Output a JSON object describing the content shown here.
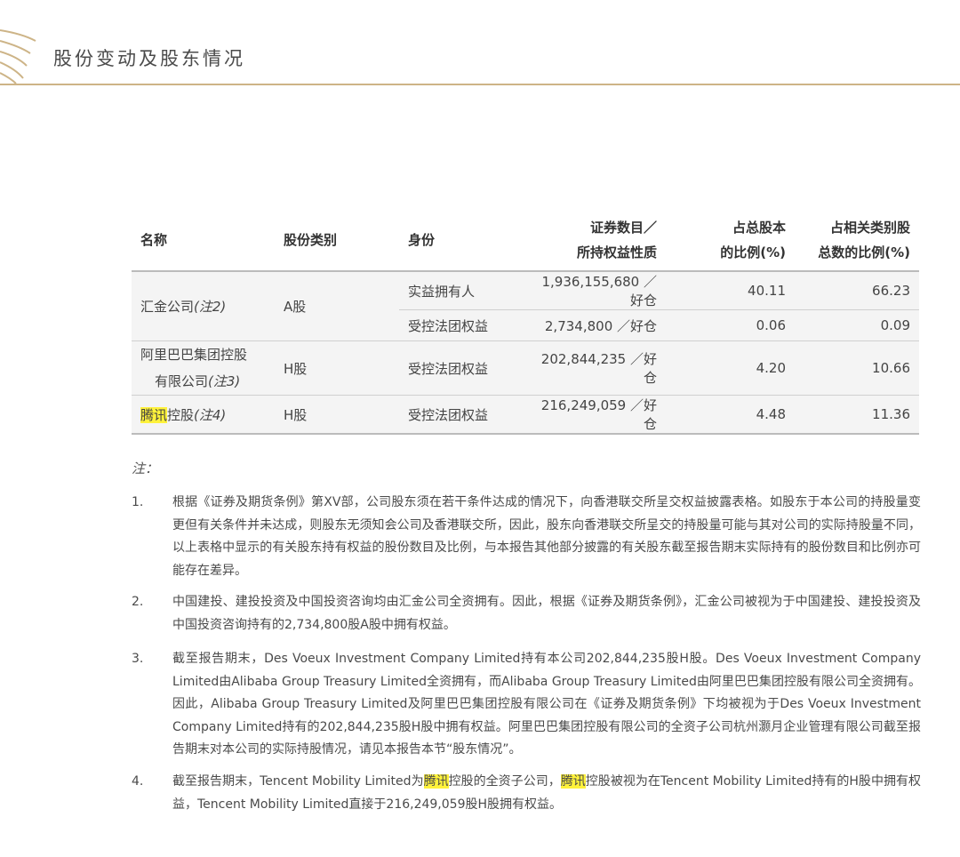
{
  "header": {
    "title": "股份变动及股东情况"
  },
  "table": {
    "headers": {
      "name": "名称",
      "share_class": "股份类别",
      "capacity": "身份",
      "securities_line1": "证券数目／",
      "securities_line2": "所持权益性质",
      "pct_total_line1": "占总股本",
      "pct_total_line2": "的比例(%)",
      "pct_class_line1": "占相关类别股",
      "pct_class_line2": "总数的比例(%)"
    },
    "rows": [
      {
        "name": "汇金公司",
        "note": "(注2)",
        "share_class": "A股",
        "sub": [
          {
            "capacity": "实益拥有人",
            "securities": "1,936,155,680 ／好仓",
            "pct_total": "40.11",
            "pct_class": "66.23"
          },
          {
            "capacity": "受控法团权益",
            "securities": "2,734,800 ／好仓",
            "pct_total": "0.06",
            "pct_class": "0.09"
          }
        ]
      },
      {
        "name_line1": "阿里巴巴集团控股",
        "name_line2": "有限公司",
        "note": "(注3)",
        "share_class": "H股",
        "capacity": "受控法团权益",
        "securities": "202,844,235 ／好仓",
        "pct_total": "4.20",
        "pct_class": "10.66"
      },
      {
        "name_highlight": "腾讯",
        "name_rest": "控股",
        "note": "(注4)",
        "share_class": "H股",
        "capacity": "受控法团权益",
        "securities": "216,249,059 ／好仓",
        "pct_total": "4.48",
        "pct_class": "11.36"
      }
    ]
  },
  "notes": {
    "label": "注：",
    "items": [
      {
        "num": "1.",
        "text": "根据《证券及期货条例》第XV部，公司股东须在若干条件达成的情况下，向香港联交所呈交权益披露表格。如股东于本公司的持股量变更但有关条件并未达成，则股东无须知会公司及香港联交所，因此，股东向香港联交所呈交的持股量可能与其对公司的实际持股量不同，以上表格中显示的有关股东持有权益的股份数目及比例，与本报告其他部分披露的有关股东截至报告期末实际持有的股份数目和比例亦可能存在差异。"
      },
      {
        "num": "2.",
        "text": "中国建投、建投投资及中国投资咨询均由汇金公司全资拥有。因此，根据《证券及期货条例》，汇金公司被视为于中国建投、建投投资及中国投资咨询持有的2,734,800股A股中拥有权益。"
      },
      {
        "num": "3.",
        "text": "截至报告期末，Des Voeux Investment Company Limited持有本公司202,844,235股H股。Des Voeux Investment Company Limited由Alibaba Group Treasury Limited全资拥有，而Alibaba Group Treasury Limited由阿里巴巴集团控股有限公司全资拥有。因此，Alibaba Group Treasury Limited及阿里巴巴集团控股有限公司在《证券及期货条例》下均被视为于Des Voeux Investment Company Limited持有的202,844,235股H股中拥有权益。阿里巴巴集团控股有限公司的全资子公司杭州灏月企业管理有限公司截至报告期末对本公司的实际持股情况，请见本报告本节“股东情况”。"
      },
      {
        "num": "4.",
        "part1": "截至报告期末，Tencent Mobility Limited为",
        "hl1": "腾讯",
        "part2": "控股的全资子公司，",
        "hl2": "腾讯",
        "part3": "控股被视为在Tencent Mobility Limited持有的H股中拥有权益，Tencent Mobility Limited直接于216,249,059股H股拥有权益。"
      }
    ]
  },
  "colors": {
    "accent_gold": "#cdb487",
    "highlight": "#fff23b",
    "row_bg": "#f4f4f4"
  }
}
